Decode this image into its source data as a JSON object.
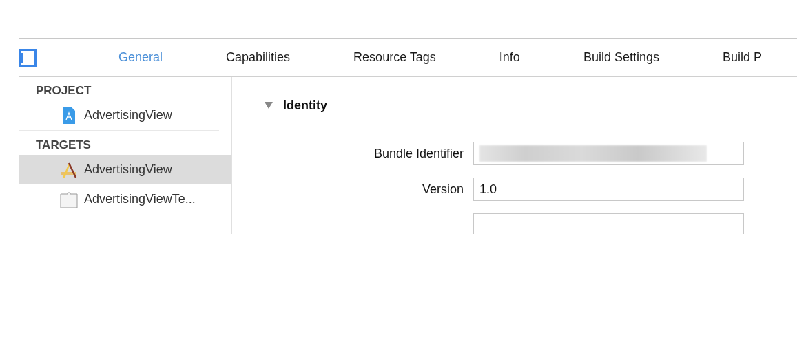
{
  "tabs": [
    {
      "label": "General",
      "selected": true
    },
    {
      "label": "Capabilities",
      "selected": false
    },
    {
      "label": "Resource Tags",
      "selected": false
    },
    {
      "label": "Info",
      "selected": false
    },
    {
      "label": "Build Settings",
      "selected": false
    },
    {
      "label": "Build P",
      "selected": false
    }
  ],
  "sidebar": {
    "sections": [
      {
        "title": "PROJECT",
        "items": [
          {
            "label": "AdvertisingView",
            "kind": "project",
            "selected": false
          }
        ]
      },
      {
        "title": "TARGETS",
        "items": [
          {
            "label": "AdvertisingView",
            "kind": "app",
            "selected": true
          },
          {
            "label": "AdvertisingViewTe...",
            "kind": "test",
            "selected": false
          }
        ]
      }
    ]
  },
  "identity": {
    "title": "Identity",
    "expanded": true,
    "fields": [
      {
        "label": "Bundle Identifier",
        "redacted": true
      },
      {
        "label": "Version",
        "value": "1.0",
        "redacted": false
      }
    ]
  }
}
